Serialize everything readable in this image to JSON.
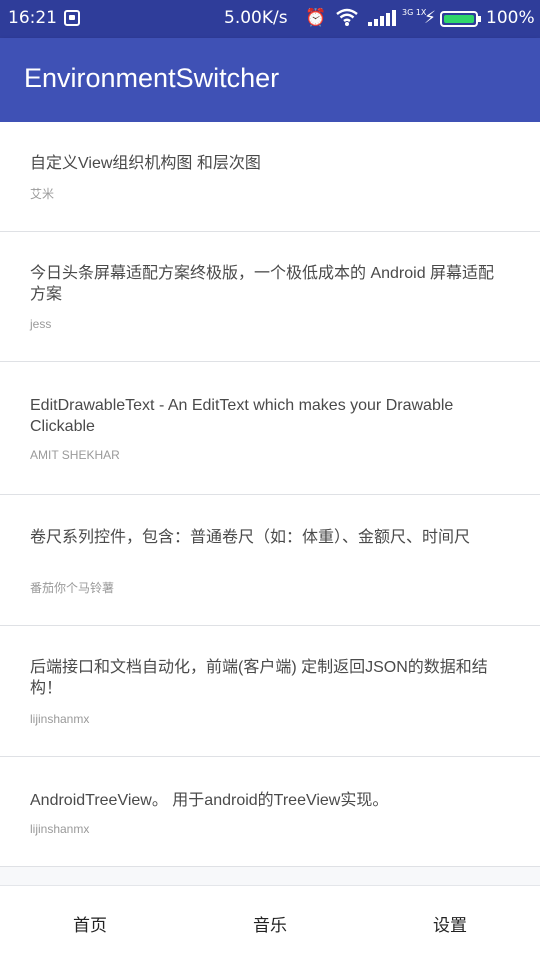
{
  "status_bar": {
    "time": "16:21",
    "speed": "5.00K/s",
    "network": "3G 1X",
    "battery": "100%",
    "battery_level": 1.0,
    "battery_color": "#2fd66b"
  },
  "app_bar": {
    "title": "EnvironmentSwitcher",
    "color": "#3f51b5"
  },
  "articles": [
    {
      "title": "自定义View组织机构图 和层次图",
      "author": "艾米"
    },
    {
      "title": "今日头条屏幕适配方案终极版，一个极低成本的 Android 屏幕适配方案",
      "author": "jess"
    },
    {
      "title": "EditDrawableText - An EditText which makes your Drawable Clickable",
      "author": "AMIT SHEKHAR"
    },
    {
      "title": "卷尺系列控件，包含：普通卷尺（如：体重）、金额尺、时间尺",
      "author": "番茄你个马铃薯"
    },
    {
      "title": "后端接口和文档自动化，前端(客户端) 定制返回JSON的数据和结构！",
      "author": "lijinshanmx"
    },
    {
      "title": "AndroidTreeView。 用于android的TreeView实现。",
      "author": "lijinshanmx"
    }
  ],
  "bottom_nav": [
    {
      "label": "首页"
    },
    {
      "label": "音乐"
    },
    {
      "label": "设置"
    }
  ]
}
